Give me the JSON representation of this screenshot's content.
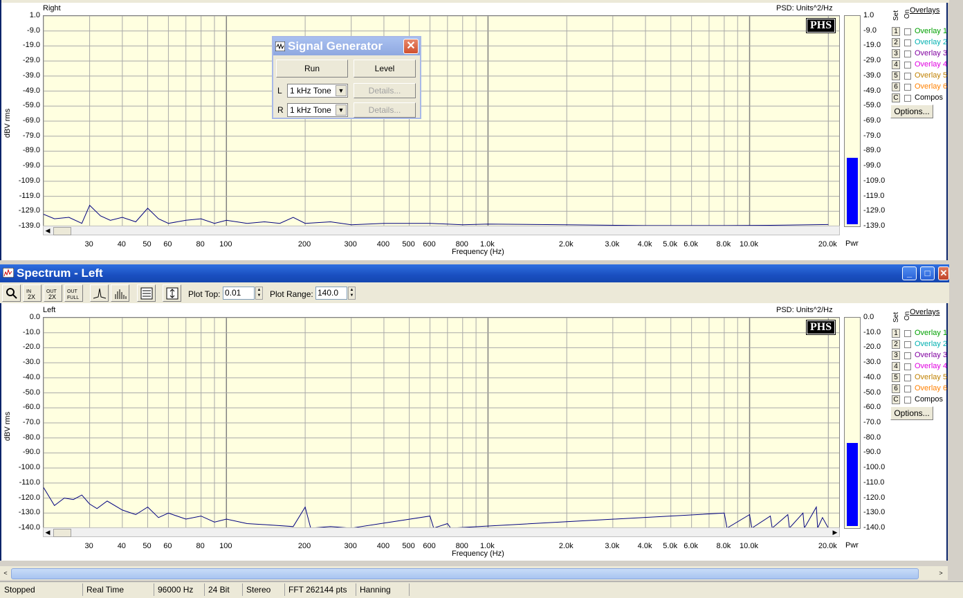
{
  "top_panel": {
    "channel": "Right",
    "psd_label": "PSD: Units^2/Hz",
    "logo": "PHS",
    "y_axis_label": "dBV rms",
    "x_axis_label": "Frequency (Hz)",
    "y_ticks": [
      "1.0",
      "-9.0",
      "-19.0",
      "-29.0",
      "-39.0",
      "-49.0",
      "-59.0",
      "-69.0",
      "-79.0",
      "-89.0",
      "-99.0",
      "-109.0",
      "-119.0",
      "-129.0",
      "-139.0"
    ],
    "meter_label": "Pwr",
    "meter_level_dB": -94
  },
  "bottom_window": {
    "title": "Spectrum - Left",
    "plot_top_label": "Plot Top:",
    "plot_top_value": "0.01",
    "plot_range_label": "Plot Range:",
    "plot_range_value": "140.0"
  },
  "bottom_panel": {
    "channel": "Left",
    "psd_label": "PSD: Units^2/Hz",
    "logo": "PHS",
    "y_axis_label": "dBV rms",
    "x_axis_label": "Frequency (Hz)",
    "y_ticks": [
      "0.0",
      "-10.0",
      "-20.0",
      "-30.0",
      "-40.0",
      "-50.0",
      "-60.0",
      "-70.0",
      "-80.0",
      "-90.0",
      "-100.0",
      "-110.0",
      "-120.0",
      "-130.0",
      "-140.0"
    ],
    "meter_label": "Pwr",
    "meter_level_dB": -84
  },
  "x_ticks": [
    {
      "f": 30,
      "label": "30"
    },
    {
      "f": 40,
      "label": "40"
    },
    {
      "f": 50,
      "label": "50"
    },
    {
      "f": 60,
      "label": "60"
    },
    {
      "f": 80,
      "label": "80"
    },
    {
      "f": 100,
      "label": "100"
    },
    {
      "f": 200,
      "label": "200"
    },
    {
      "f": 300,
      "label": "300"
    },
    {
      "f": 400,
      "label": "400"
    },
    {
      "f": 500,
      "label": "500"
    },
    {
      "f": 600,
      "label": "600"
    },
    {
      "f": 800,
      "label": "800"
    },
    {
      "f": 1000,
      "label": "1.0k"
    },
    {
      "f": 2000,
      "label": "2.0k"
    },
    {
      "f": 3000,
      "label": "3.0k"
    },
    {
      "f": 4000,
      "label": "4.0k"
    },
    {
      "f": 5000,
      "label": "5.0k"
    },
    {
      "f": 6000,
      "label": "6.0k"
    },
    {
      "f": 8000,
      "label": "8.0k"
    },
    {
      "f": 10000,
      "label": "10.0k"
    },
    {
      "f": 20000,
      "label": "20.0k"
    }
  ],
  "overlays": {
    "title": "Overlays",
    "set_label": "Set",
    "on_label": "On",
    "items": [
      {
        "num": "1",
        "label": "Overlay 1",
        "color": "#00a000"
      },
      {
        "num": "2",
        "label": "Overlay 2",
        "color": "#00b0b0"
      },
      {
        "num": "3",
        "label": "Overlay 3",
        "color": "#8000a0"
      },
      {
        "num": "4",
        "label": "Overlay 4",
        "color": "#e000e0"
      },
      {
        "num": "5",
        "label": "Overlay 5",
        "color": "#c08000"
      },
      {
        "num": "6",
        "label": "Overlay 6",
        "color": "#ff8000"
      },
      {
        "num": "C",
        "label": "Compos",
        "color": "#000000"
      }
    ],
    "options_label": "Options..."
  },
  "signal_generator": {
    "title": "Signal Generator",
    "run_label": "Run",
    "level_label": "Level",
    "l_label": "L",
    "r_label": "R",
    "l_value": "1 kHz Tone",
    "r_value": "1 kHz Tone",
    "details_label": "Details..."
  },
  "status": {
    "state": "Stopped",
    "mode": "Real Time",
    "rate": "96000 Hz",
    "bits": "24 Bit",
    "channels": "Stereo",
    "fft": "FFT 262144 pts",
    "window": "Hanning"
  },
  "colors": {
    "plot_bg": "#ffffe0",
    "trace": "#000080",
    "meter": "#0000ff"
  },
  "chart_data": [
    {
      "type": "line",
      "title": "Right",
      "xlabel": "Frequency (Hz)",
      "ylabel": "dBV rms",
      "x_scale": "log",
      "xlim": [
        20,
        22000
      ],
      "ylim": [
        -139,
        1
      ],
      "grid": true,
      "series": [
        {
          "points": [
            [
              20,
              -131
            ],
            [
              22,
              -134
            ],
            [
              25,
              -133
            ],
            [
              28,
              -137
            ],
            [
              30,
              -125
            ],
            [
              33,
              -132
            ],
            [
              36,
              -135
            ],
            [
              40,
              -133
            ],
            [
              45,
              -136
            ],
            [
              50,
              -127
            ],
            [
              55,
              -134
            ],
            [
              60,
              -137
            ],
            [
              70,
              -135
            ],
            [
              80,
              -134
            ],
            [
              90,
              -137
            ],
            [
              100,
              -135
            ],
            [
              120,
              -137
            ],
            [
              140,
              -136
            ],
            [
              160,
              -137
            ],
            [
              180,
              -133
            ],
            [
              200,
              -137
            ],
            [
              250,
              -136
            ],
            [
              300,
              -138
            ],
            [
              400,
              -137
            ],
            [
              500,
              -137
            ],
            [
              600,
              -137
            ],
            [
              800,
              -138
            ],
            [
              1000,
              -137.5
            ],
            [
              2000,
              -138
            ],
            [
              4000,
              -138.5
            ],
            [
              8000,
              -138.5
            ],
            [
              12000,
              -138.3
            ],
            [
              20000,
              -137.8
            ]
          ]
        }
      ]
    },
    {
      "type": "line",
      "title": "Left",
      "xlabel": "Frequency (Hz)",
      "ylabel": "dBV rms",
      "x_scale": "log",
      "xlim": [
        20,
        22000
      ],
      "ylim": [
        -140,
        0
      ],
      "grid": true,
      "series": [
        {
          "points": [
            [
              20,
              -113
            ],
            [
              22,
              -125
            ],
            [
              24,
              -120
            ],
            [
              26,
              -121
            ],
            [
              28,
              -118
            ],
            [
              30,
              -124
            ],
            [
              32,
              -127
            ],
            [
              35,
              -122
            ],
            [
              40,
              -128
            ],
            [
              45,
              -131
            ],
            [
              50,
              -126
            ],
            [
              55,
              -133
            ],
            [
              60,
              -130
            ],
            [
              70,
              -134
            ],
            [
              80,
              -132
            ],
            [
              90,
              -136
            ],
            [
              100,
              -134
            ],
            [
              120,
              -137
            ],
            [
              150,
              -138
            ],
            [
              180,
              -139
            ],
            [
              200,
              -126
            ],
            [
              210,
              -140
            ],
            [
              250,
              -139
            ],
            [
              300,
              -140
            ],
            [
              600,
              -132
            ],
            [
              620,
              -140
            ],
            [
              700,
              -137
            ],
            [
              720,
              -140
            ],
            [
              8000,
              -130
            ],
            [
              8200,
              -140
            ],
            [
              10000,
              -131
            ],
            [
              10200,
              -140
            ],
            [
              12000,
              -132
            ],
            [
              12200,
              -140
            ],
            [
              14000,
              -131
            ],
            [
              14200,
              -140
            ],
            [
              16000,
              -130
            ],
            [
              16200,
              -140
            ],
            [
              18000,
              -126
            ],
            [
              18200,
              -140
            ],
            [
              19000,
              -133
            ],
            [
              20000,
              -140
            ]
          ]
        }
      ]
    }
  ]
}
